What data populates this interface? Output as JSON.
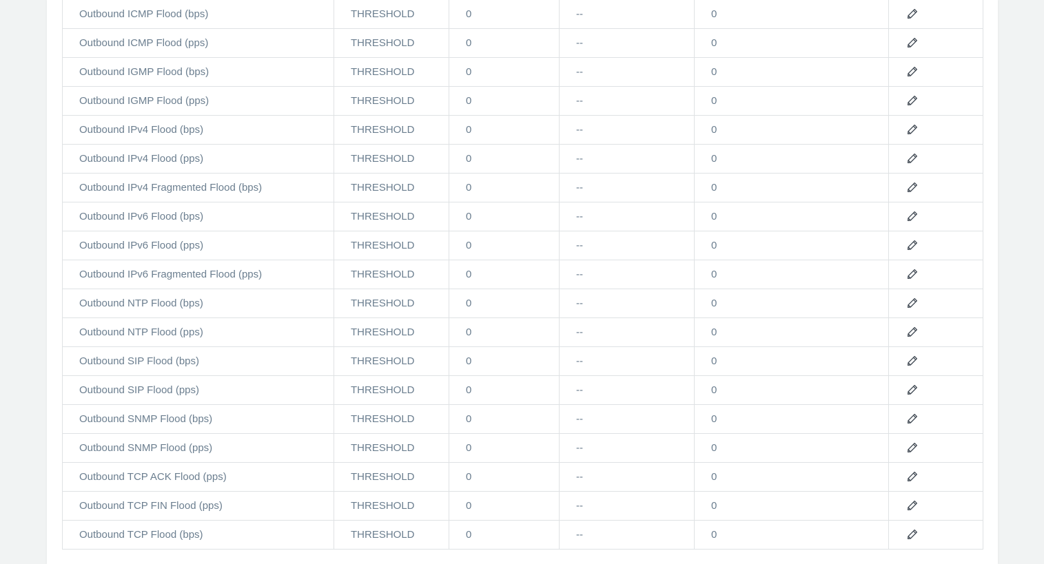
{
  "table": {
    "rows": [
      {
        "name": "Outbound ICMP Flood (bps)",
        "type": "THRESHOLD",
        "value1": "0",
        "value2": "--",
        "value3": "0",
        "action_icon": "pencil-icon"
      },
      {
        "name": "Outbound ICMP Flood (pps)",
        "type": "THRESHOLD",
        "value1": "0",
        "value2": "--",
        "value3": "0",
        "action_icon": "pencil-icon"
      },
      {
        "name": "Outbound IGMP Flood (bps)",
        "type": "THRESHOLD",
        "value1": "0",
        "value2": "--",
        "value3": "0",
        "action_icon": "pencil-icon"
      },
      {
        "name": "Outbound IGMP Flood (pps)",
        "type": "THRESHOLD",
        "value1": "0",
        "value2": "--",
        "value3": "0",
        "action_icon": "pencil-icon"
      },
      {
        "name": "Outbound IPv4 Flood (bps)",
        "type": "THRESHOLD",
        "value1": "0",
        "value2": "--",
        "value3": "0",
        "action_icon": "pencil-icon"
      },
      {
        "name": "Outbound IPv4 Flood (pps)",
        "type": "THRESHOLD",
        "value1": "0",
        "value2": "--",
        "value3": "0",
        "action_icon": "pencil-icon"
      },
      {
        "name": "Outbound IPv4 Fragmented Flood (bps)",
        "type": "THRESHOLD",
        "value1": "0",
        "value2": "--",
        "value3": "0",
        "action_icon": "pencil-icon"
      },
      {
        "name": "Outbound IPv6 Flood (bps)",
        "type": "THRESHOLD",
        "value1": "0",
        "value2": "--",
        "value3": "0",
        "action_icon": "pencil-icon"
      },
      {
        "name": "Outbound IPv6 Flood (pps)",
        "type": "THRESHOLD",
        "value1": "0",
        "value2": "--",
        "value3": "0",
        "action_icon": "pencil-icon"
      },
      {
        "name": "Outbound IPv6 Fragmented Flood (pps)",
        "type": "THRESHOLD",
        "value1": "0",
        "value2": "--",
        "value3": "0",
        "action_icon": "pencil-icon"
      },
      {
        "name": "Outbound NTP Flood (bps)",
        "type": "THRESHOLD",
        "value1": "0",
        "value2": "--",
        "value3": "0",
        "action_icon": "pencil-icon"
      },
      {
        "name": "Outbound NTP Flood (pps)",
        "type": "THRESHOLD",
        "value1": "0",
        "value2": "--",
        "value3": "0",
        "action_icon": "pencil-icon"
      },
      {
        "name": "Outbound SIP Flood (bps)",
        "type": "THRESHOLD",
        "value1": "0",
        "value2": "--",
        "value3": "0",
        "action_icon": "pencil-icon"
      },
      {
        "name": "Outbound SIP Flood (pps)",
        "type": "THRESHOLD",
        "value1": "0",
        "value2": "--",
        "value3": "0",
        "action_icon": "pencil-icon"
      },
      {
        "name": "Outbound SNMP Flood (bps)",
        "type": "THRESHOLD",
        "value1": "0",
        "value2": "--",
        "value3": "0",
        "action_icon": "pencil-icon"
      },
      {
        "name": "Outbound SNMP Flood (pps)",
        "type": "THRESHOLD",
        "value1": "0",
        "value2": "--",
        "value3": "0",
        "action_icon": "pencil-icon"
      },
      {
        "name": "Outbound TCP ACK Flood (pps)",
        "type": "THRESHOLD",
        "value1": "0",
        "value2": "--",
        "value3": "0",
        "action_icon": "pencil-icon"
      },
      {
        "name": "Outbound TCP FIN Flood (pps)",
        "type": "THRESHOLD",
        "value1": "0",
        "value2": "--",
        "value3": "0",
        "action_icon": "pencil-icon"
      },
      {
        "name": "Outbound TCP Flood (bps)",
        "type": "THRESHOLD",
        "value1": "0",
        "value2": "--",
        "value3": "0",
        "action_icon": "pencil-icon"
      }
    ]
  },
  "colors": {
    "text": "#6b7e8f",
    "border": "#dfe2e4",
    "icon": "#3d4650",
    "background": "#f1f3f3"
  }
}
